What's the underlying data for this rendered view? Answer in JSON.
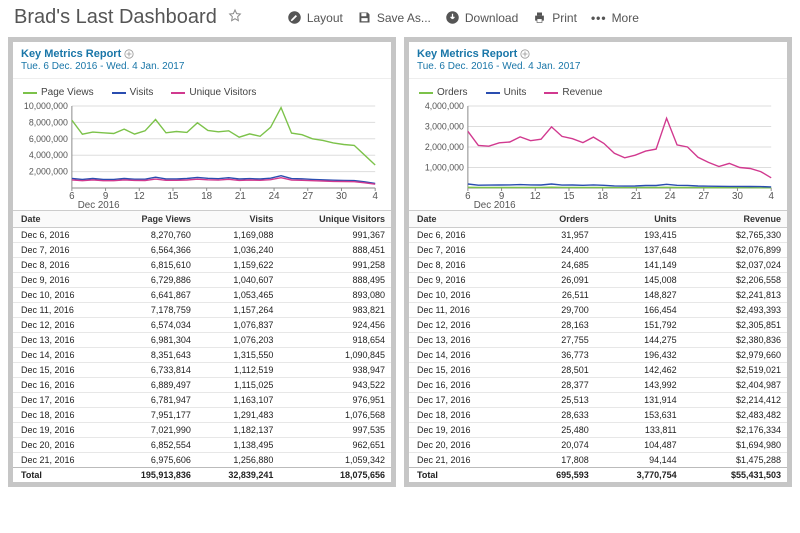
{
  "header": {
    "title": "Brad's Last Dashboard",
    "buttons": {
      "layout": "Layout",
      "save": "Save As...",
      "download": "Download",
      "print": "Print",
      "more": "More"
    }
  },
  "left_panel": {
    "title": "Key Metrics Report",
    "date_range": "Tue. 6 Dec. 2016 - Wed. 4 Jan. 2017",
    "legend": [
      "Page Views",
      "Visits",
      "Unique Visitors"
    ],
    "legend_colors": [
      "#7cc24a",
      "#2a4db0",
      "#d1398f"
    ],
    "xlabel": "Dec 2016",
    "columns": [
      "Date",
      "Page Views",
      "Visits",
      "Unique Visitors"
    ],
    "rows": [
      [
        "Dec 6, 2016",
        "8,270,760",
        "1,169,088",
        "991,367"
      ],
      [
        "Dec 7, 2016",
        "6,564,366",
        "1,036,240",
        "888,451"
      ],
      [
        "Dec 8, 2016",
        "6,815,610",
        "1,159,622",
        "991,258"
      ],
      [
        "Dec 9, 2016",
        "6,729,886",
        "1,040,607",
        "888,495"
      ],
      [
        "Dec 10, 2016",
        "6,641,867",
        "1,053,465",
        "893,080"
      ],
      [
        "Dec 11, 2016",
        "7,178,759",
        "1,157,264",
        "983,821"
      ],
      [
        "Dec 12, 2016",
        "6,574,034",
        "1,076,837",
        "924,456"
      ],
      [
        "Dec 13, 2016",
        "6,981,304",
        "1,076,203",
        "918,654"
      ],
      [
        "Dec 14, 2016",
        "8,351,643",
        "1,315,550",
        "1,090,845"
      ],
      [
        "Dec 15, 2016",
        "6,733,814",
        "1,112,519",
        "938,947"
      ],
      [
        "Dec 16, 2016",
        "6,889,497",
        "1,115,025",
        "943,522"
      ],
      [
        "Dec 17, 2016",
        "6,781,947",
        "1,163,107",
        "976,951"
      ],
      [
        "Dec 18, 2016",
        "7,951,177",
        "1,291,483",
        "1,076,568"
      ],
      [
        "Dec 19, 2016",
        "7,021,990",
        "1,182,137",
        "997,535"
      ],
      [
        "Dec 20, 2016",
        "6,852,554",
        "1,138,495",
        "962,651"
      ],
      [
        "Dec 21, 2016",
        "6,975,606",
        "1,256,880",
        "1,059,342"
      ]
    ],
    "total": [
      "Total",
      "195,913,836",
      "32,839,241",
      "18,075,656"
    ]
  },
  "right_panel": {
    "title": "Key Metrics Report",
    "date_range": "Tue. 6 Dec. 2016 - Wed. 4 Jan. 2017",
    "legend": [
      "Orders",
      "Units",
      "Revenue"
    ],
    "legend_colors": [
      "#7cc24a",
      "#2a4db0",
      "#d1398f"
    ],
    "xlabel": "Dec 2016",
    "columns": [
      "Date",
      "Orders",
      "Units",
      "Revenue"
    ],
    "rows": [
      [
        "Dec 6, 2016",
        "31,957",
        "193,415",
        "$2,765,330"
      ],
      [
        "Dec 7, 2016",
        "24,400",
        "137,648",
        "$2,076,899"
      ],
      [
        "Dec 8, 2016",
        "24,685",
        "141,149",
        "$2,037,024"
      ],
      [
        "Dec 9, 2016",
        "26,091",
        "145,008",
        "$2,206,558"
      ],
      [
        "Dec 10, 2016",
        "26,511",
        "148,827",
        "$2,241,813"
      ],
      [
        "Dec 11, 2016",
        "29,700",
        "166,454",
        "$2,493,393"
      ],
      [
        "Dec 12, 2016",
        "28,163",
        "151,792",
        "$2,305,851"
      ],
      [
        "Dec 13, 2016",
        "27,755",
        "144,275",
        "$2,380,836"
      ],
      [
        "Dec 14, 2016",
        "36,773",
        "196,432",
        "$2,979,660"
      ],
      [
        "Dec 15, 2016",
        "28,501",
        "142,462",
        "$2,519,021"
      ],
      [
        "Dec 16, 2016",
        "28,377",
        "143,992",
        "$2,404,987"
      ],
      [
        "Dec 17, 2016",
        "25,513",
        "131,914",
        "$2,214,412"
      ],
      [
        "Dec 18, 2016",
        "28,633",
        "153,631",
        "$2,483,482"
      ],
      [
        "Dec 19, 2016",
        "25,480",
        "133,811",
        "$2,176,334"
      ],
      [
        "Dec 20, 2016",
        "20,074",
        "104,487",
        "$1,694,980"
      ],
      [
        "Dec 21, 2016",
        "17,808",
        "94,144",
        "$1,475,288"
      ]
    ],
    "total": [
      "Total",
      "695,593",
      "3,770,754",
      "$55,431,503"
    ]
  },
  "chart_data": [
    {
      "type": "line",
      "title": "Key Metrics Report",
      "xlabel": "Dec 2016",
      "ylabel": "",
      "ylim": [
        0,
        10000000
      ],
      "x_ticks": [
        6,
        9,
        12,
        15,
        18,
        21,
        24,
        27,
        30,
        4
      ],
      "y_ticks": [
        2000000,
        4000000,
        6000000,
        8000000,
        10000000
      ],
      "y_tick_labels": [
        "2,000,000",
        "4,000,000",
        "6,000,000",
        "8,000,000",
        "10,000,000"
      ],
      "series": [
        {
          "name": "Page Views",
          "color": "#7cc24a",
          "values": [
            8270760,
            6564366,
            6815610,
            6729886,
            6641867,
            7178759,
            6574034,
            6981304,
            8351643,
            6733814,
            6889497,
            6781947,
            7951177,
            7021990,
            6852554,
            6975606,
            6200000,
            6600000,
            6300000,
            7400000,
            9800000,
            6700000,
            6500000,
            6000000,
            5800000,
            5500000,
            5300000,
            5200000,
            4000000,
            2800000
          ]
        },
        {
          "name": "Visits",
          "color": "#2a4db0",
          "values": [
            1169088,
            1036240,
            1159622,
            1040607,
            1053465,
            1157264,
            1076837,
            1076203,
            1315550,
            1112519,
            1115025,
            1163107,
            1291483,
            1182137,
            1138495,
            1256880,
            1100000,
            1150000,
            1100000,
            1200000,
            1500000,
            1150000,
            1120000,
            1050000,
            1000000,
            950000,
            920000,
            900000,
            750000,
            550000
          ]
        },
        {
          "name": "Unique Visitors",
          "color": "#d1398f",
          "values": [
            991367,
            888451,
            991258,
            888495,
            893080,
            983821,
            924456,
            918654,
            1090845,
            938947,
            943522,
            976951,
            1076568,
            997535,
            962651,
            1059342,
            930000,
            970000,
            940000,
            1010000,
            1260000,
            965000,
            940000,
            890000,
            850000,
            810000,
            790000,
            770000,
            640000,
            460000
          ]
        }
      ]
    },
    {
      "type": "line",
      "title": "Key Metrics Report",
      "xlabel": "Dec 2016",
      "ylabel": "",
      "ylim": [
        0,
        4000000
      ],
      "x_ticks": [
        6,
        9,
        12,
        15,
        18,
        21,
        24,
        27,
        30,
        4
      ],
      "y_ticks": [
        1000000,
        2000000,
        3000000,
        4000000
      ],
      "y_tick_labels": [
        "1,000,000",
        "2,000,000",
        "3,000,000",
        "4,000,000"
      ],
      "series": [
        {
          "name": "Orders",
          "color": "#7cc24a",
          "values": [
            31957,
            24400,
            24685,
            26091,
            26511,
            29700,
            28163,
            27755,
            36773,
            28501,
            28377,
            25513,
            28633,
            25480,
            20074,
            17808,
            18000,
            22000,
            22000,
            33000,
            24000,
            23000,
            18000,
            16000,
            15000,
            15000,
            14000,
            13000,
            12000,
            10000
          ]
        },
        {
          "name": "Units",
          "color": "#2a4db0",
          "values": [
            193415,
            137648,
            141149,
            145008,
            148827,
            166454,
            151792,
            144275,
            196432,
            142462,
            143992,
            131914,
            153631,
            133811,
            104487,
            94144,
            96000,
            120000,
            120000,
            180000,
            130000,
            125000,
            98000,
            88000,
            82000,
            80000,
            78000,
            72000,
            66000,
            55000
          ]
        },
        {
          "name": "Revenue",
          "color": "#d1398f",
          "values": [
            2765330,
            2076899,
            2037024,
            2206558,
            2241813,
            2493393,
            2305851,
            2380836,
            2979660,
            2519021,
            2404987,
            2214412,
            2483482,
            2176334,
            1694980,
            1475288,
            1600000,
            1800000,
            1900000,
            3400000,
            2100000,
            2000000,
            1500000,
            1250000,
            1050000,
            1200000,
            1000000,
            950000,
            800000,
            500000
          ]
        }
      ]
    }
  ]
}
